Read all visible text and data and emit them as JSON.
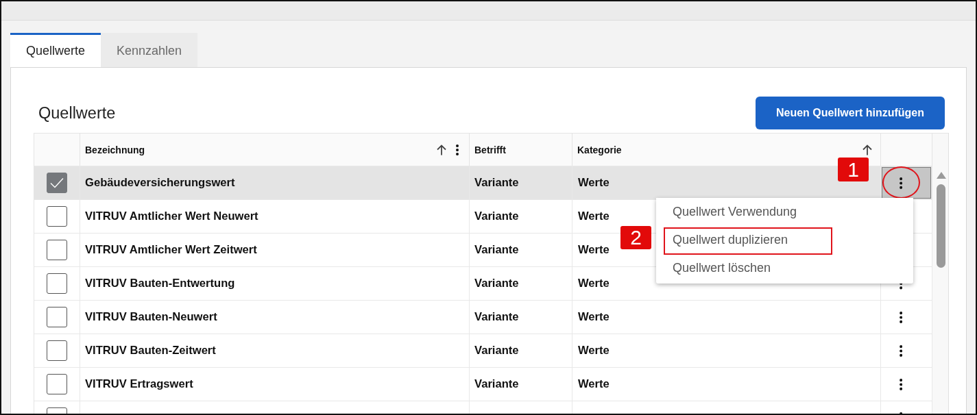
{
  "tabs": [
    {
      "label": "Quellwerte",
      "selected": true
    },
    {
      "label": "Kennzahlen",
      "selected": false
    }
  ],
  "section": {
    "title": "Quellwerte",
    "add_button": "Neuen Quellwert hinzufügen"
  },
  "table": {
    "columns": [
      {
        "label": "Bezeichnung",
        "sorted": true,
        "menu": true
      },
      {
        "label": "Betrifft",
        "sorted": false,
        "menu": false
      },
      {
        "label": "Kategorie",
        "sorted": true,
        "menu": false
      }
    ],
    "rows": [
      {
        "name": "Gebäudeversicherungswert",
        "betrifft": "Variante",
        "kategorie": "Werte",
        "checked": true,
        "selected": true,
        "menu_open": true,
        "highlighted": true,
        "callout": "1"
      },
      {
        "name": "VITRUV Amtlicher Wert Neuwert",
        "betrifft": "Variante",
        "kategorie": "Werte",
        "checked": false,
        "selected": false,
        "menu_open": false,
        "highlighted": false
      },
      {
        "name": "VITRUV Amtlicher Wert Zeitwert",
        "betrifft": "Variante",
        "kategorie": "Werte",
        "checked": false,
        "selected": false,
        "menu_open": false,
        "highlighted": false
      },
      {
        "name": "VITRUV Bauten-Entwertung",
        "betrifft": "Variante",
        "kategorie": "Werte",
        "checked": false,
        "selected": false,
        "menu_open": false,
        "highlighted": false
      },
      {
        "name": "VITRUV Bauten-Neuwert",
        "betrifft": "Variante",
        "kategorie": "Werte",
        "checked": false,
        "selected": false,
        "menu_open": false,
        "highlighted": false
      },
      {
        "name": "VITRUV Bauten-Zeitwert",
        "betrifft": "Variante",
        "kategorie": "Werte",
        "checked": false,
        "selected": false,
        "menu_open": false,
        "highlighted": false
      },
      {
        "name": "VITRUV Ertragswert",
        "betrifft": "Variante",
        "kategorie": "Werte",
        "checked": false,
        "selected": false,
        "menu_open": false,
        "highlighted": false
      },
      {
        "selected": false,
        "menu_open": false,
        "highlighted": false
      }
    ],
    "context_menu": {
      "items": [
        {
          "label": "Quellwert Verwendung",
          "highlighted": false
        },
        {
          "label": "Quellwert duplizieren",
          "highlighted": true,
          "callout": "2"
        },
        {
          "label": "Quellwert löschen",
          "highlighted": false
        }
      ]
    }
  }
}
